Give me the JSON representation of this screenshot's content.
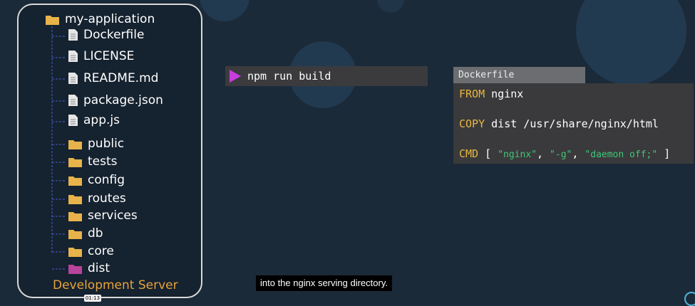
{
  "tree": {
    "root": "my-application",
    "files": [
      "Dockerfile",
      "LICENSE",
      "README.md",
      "package.json",
      "app.js"
    ],
    "folders": [
      "public",
      "tests",
      "config",
      "routes",
      "services",
      "db",
      "core"
    ],
    "highlighted_folder": "dist",
    "label": "Development Server"
  },
  "terminal": {
    "command": "npm run build"
  },
  "dockerfile": {
    "title": "Dockerfile",
    "lines": [
      {
        "keyword": "FROM",
        "rest": "nginx"
      },
      {
        "keyword": "COPY",
        "rest": "dist /usr/share/nginx/html"
      },
      {
        "keyword": "CMD",
        "open": "[",
        "args": [
          "\"nginx\"",
          "\"-g\"",
          "\"daemon off;\""
        ],
        "close": "]"
      }
    ]
  },
  "video": {
    "caption": "into the nginx serving directory.",
    "timestamp": "01:13"
  },
  "colors": {
    "background": "#1b2a38",
    "folder": "#e7b34a",
    "dist_folder": "#b8449c",
    "keyword": "#e7b73f",
    "string": "#3fc778",
    "label": "#e8a33c",
    "play": "#c93ce0"
  }
}
